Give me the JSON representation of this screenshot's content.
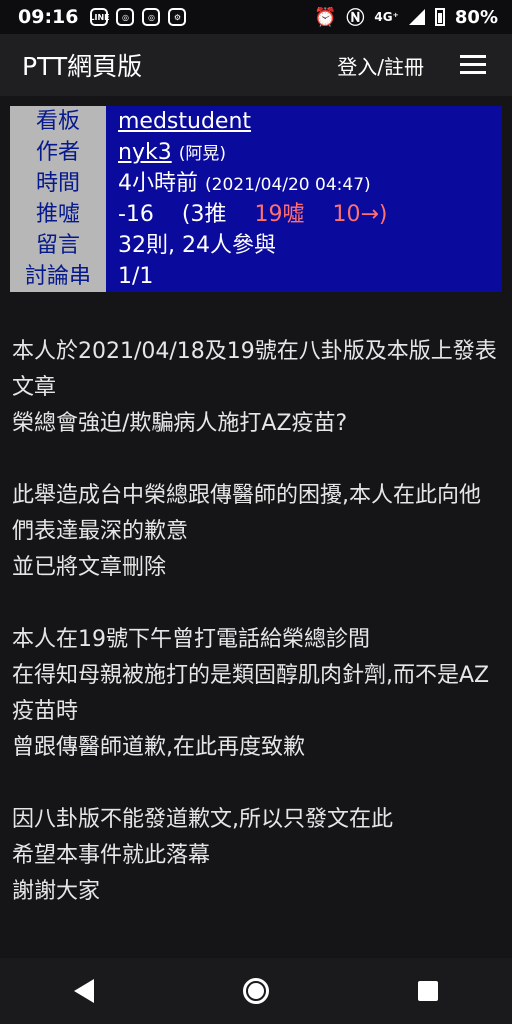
{
  "status_bar": {
    "time": "09:16",
    "network": "4G⁺",
    "battery": "80%",
    "icons": [
      "line-icon",
      "instagram-icon",
      "instagram-icon",
      "settings-icon",
      "alarm-icon",
      "nfc-icon",
      "signal-icon",
      "battery-icon"
    ]
  },
  "header": {
    "title": "PTT網頁版",
    "login": "登入/註冊",
    "menu_icon": "hamburger-icon"
  },
  "meta": {
    "board_label": "看板",
    "board": "medstudent",
    "author_label": "作者",
    "author_id": "nyk3",
    "author_nick": "(阿晃)",
    "time_label": "時間",
    "time_rel": "4小時前",
    "time_abs": "(2021/04/20 04:47)",
    "score_label": "推噓",
    "score": "-16",
    "push": "(3推",
    "boo": "19噓",
    "arrow": "10→)",
    "comments_label": "留言",
    "comments": "32則, 24人參與",
    "thread_label": "討論串",
    "thread": "1/1"
  },
  "article": {
    "lines": [
      "本人於2021/04/18及19號在八卦版及本版上發表文章",
      "榮總會強迫/欺騙病人施打AZ疫苗?",
      "",
      "此舉造成台中榮總跟傳醫師的困擾,本人在此向他們表達最深的歉意",
      "並已將文章刪除",
      "",
      "本人在19號下午曾打電話給榮總診間",
      "在得知母親被施打的是類固醇肌肉針劑,而不是AZ疫苗時",
      "曾跟傳醫師道歉,在此再度致歉",
      "",
      "因八卦版不能發道歉文,所以只發文在此",
      "希望本事件就此落幕",
      "謝謝大家"
    ]
  },
  "colors": {
    "meta_key_bg": "#b7b7b7",
    "meta_value_bg": "#0a0a9c",
    "boo_red": "#ff6f6f",
    "page_bg": "#151518"
  }
}
